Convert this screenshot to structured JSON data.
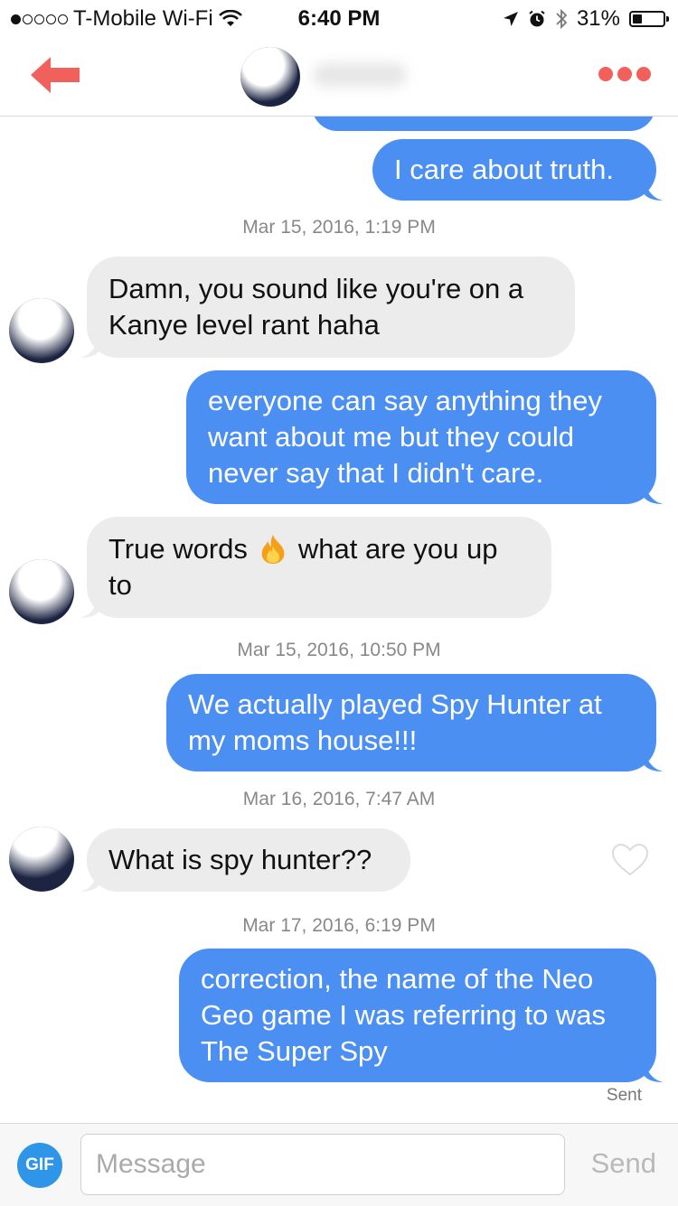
{
  "status_bar": {
    "carrier": "T-Mobile Wi-Fi",
    "signal_bars_filled": 1,
    "signal_bars_total": 5,
    "time": "6:40 PM",
    "battery_percent": "31%",
    "battery_level": 0.31
  },
  "nav": {
    "back_icon": "back-arrow-icon",
    "contact_name": "",
    "more_icon": "more-dots-icon",
    "accent_color": "#f2605c"
  },
  "thread": {
    "outgoing_color": "#4b8ff2",
    "incoming_color": "#ececec",
    "messages": [
      {
        "direction": "out",
        "text": ""
      },
      {
        "direction": "out",
        "text": "I care about truth."
      },
      {
        "type": "timestamp",
        "text": "Mar 15, 2016, 1:19 PM"
      },
      {
        "direction": "in",
        "lines": [
          "Damn, you sound like you're on a",
          "Kanye level rant haha"
        ]
      },
      {
        "direction": "out",
        "lines": [
          "everyone can say anything they",
          "want about me but they could",
          "never say that I didn't care."
        ]
      },
      {
        "direction": "in",
        "lines": [
          "True words",
          "what are you up",
          "to"
        ],
        "emoji": "fire-emoji-icon"
      },
      {
        "type": "timestamp",
        "text": "Mar 15, 2016, 10:50 PM"
      },
      {
        "direction": "out",
        "lines": [
          "We actually played Spy Hunter at",
          "my moms house!!!"
        ]
      },
      {
        "type": "timestamp",
        "text": "Mar 16, 2016, 7:47 AM"
      },
      {
        "direction": "in",
        "text": "What is spy hunter??",
        "like_icon": "heart-outline-icon"
      },
      {
        "type": "timestamp",
        "text": "Mar 17, 2016, 6:19 PM"
      },
      {
        "direction": "out",
        "lines": [
          "correction, the name of the Neo",
          "Geo game I was referring to was",
          "The Super Spy"
        ]
      }
    ],
    "status": "Sent"
  },
  "input_bar": {
    "gif_label": "GIF",
    "placeholder": "Message",
    "value": "",
    "send_label": "Send"
  }
}
